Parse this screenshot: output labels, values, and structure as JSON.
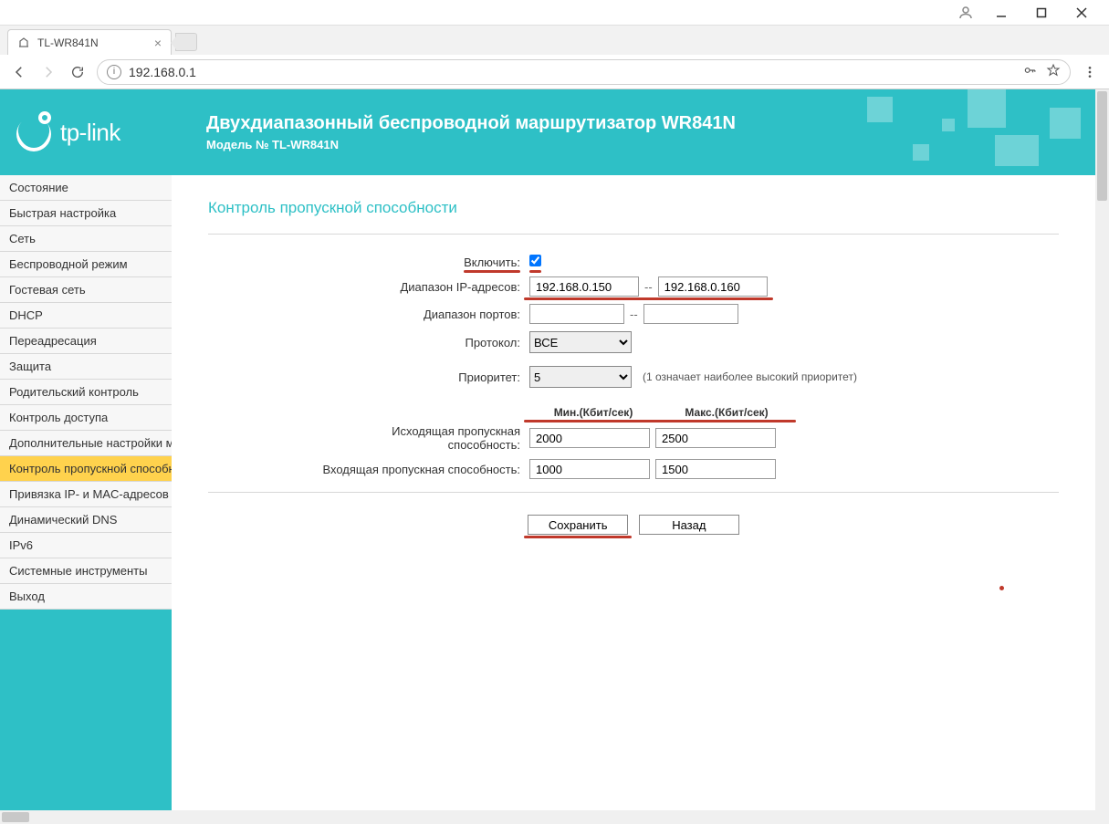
{
  "window": {
    "tab_title": "TL-WR841N",
    "url": "192.168.0.1"
  },
  "header": {
    "brand": "tp-link",
    "title": "Двухдиапазонный беспроводной маршрутизатор WR841N",
    "model": "Модель № TL-WR841N"
  },
  "sidebar": {
    "items": [
      "Состояние",
      "Быстрая настройка",
      "Сеть",
      "Беспроводной режим",
      "Гостевая сеть",
      "DHCP",
      "Переадресация",
      "Защита",
      "Родительский контроль",
      "Контроль доступа",
      "Дополнительные настройки маршрутизации",
      "Контроль пропускной способности",
      "Привязка IP- и MAC-адресов",
      "Динамический DNS",
      "IPv6",
      "Системные инструменты",
      "Выход"
    ],
    "active_index": 11
  },
  "content": {
    "section_title": "Контроль пропускной способности",
    "labels": {
      "enable": "Включить:",
      "ip_range": "Диапазон IP-адресов:",
      "port_range": "Диапазон портов:",
      "protocol": "Протокол:",
      "priority": "Приоритет:",
      "priority_hint": "(1 означает наиболее высокий приоритет)",
      "col_min": "Мин.(Кбит/сек)",
      "col_max": "Макс.(Кбит/сек)",
      "egress": "Исходящая пропускная способность:",
      "ingress": "Входящая пропускная способность:"
    },
    "values": {
      "enable_checked": true,
      "ip_from": "192.168.0.150",
      "ip_to": "192.168.0.160",
      "port_from": "",
      "port_to": "",
      "protocol": "ВСЕ",
      "priority": "5",
      "egress_min": "2000",
      "egress_max": "2500",
      "ingress_min": "1000",
      "ingress_max": "1500"
    },
    "buttons": {
      "save": "Сохранить",
      "back": "Назад"
    }
  }
}
